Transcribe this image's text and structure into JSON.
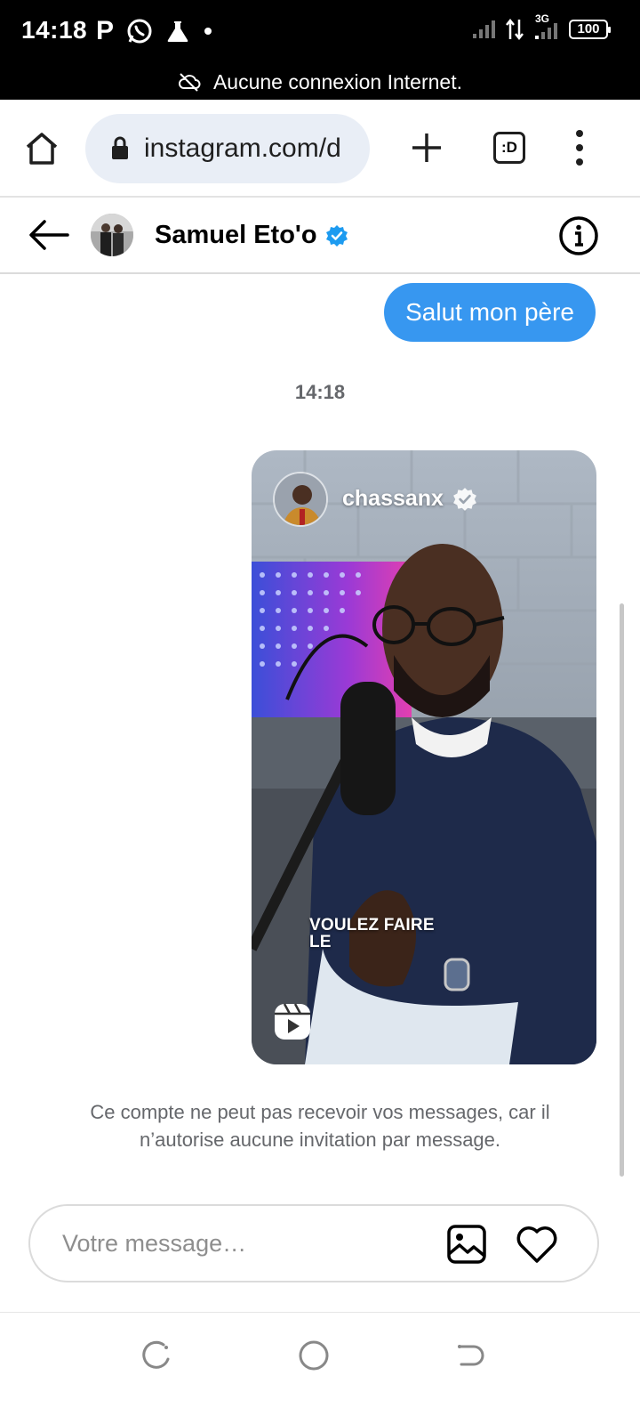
{
  "status_bar": {
    "time": "14:18",
    "app_letter": "P",
    "network": "3G",
    "battery": "100",
    "offline_message": "Aucune connexion Internet."
  },
  "browser": {
    "url": "instagram.com/d",
    "tabs_label": ":D"
  },
  "chat": {
    "contact_name": "Samuel Eto'o",
    "verified": true,
    "accent_color": "#3797f0"
  },
  "messages": {
    "outgoing_text": "Salut mon père",
    "timestamp": "14:18",
    "reel": {
      "username": "chassanx",
      "caption_line1": "VOULEZ FAIRE",
      "caption_line2": "LE"
    },
    "notice": "Ce compte ne peut pas recevoir vos messages, car il n’autorise aucune invitation par message."
  },
  "composer": {
    "placeholder": "Votre message…"
  }
}
